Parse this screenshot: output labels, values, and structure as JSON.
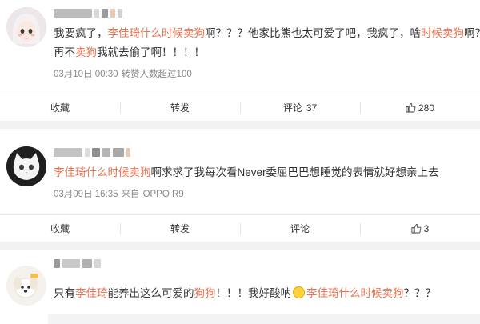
{
  "colors": {
    "highlight": "#eb7350",
    "meta": "#888888",
    "separator": "#f2f2f5"
  },
  "posts": [
    {
      "text_parts": [
        {
          "t": "我要疯了，",
          "hl": false
        },
        {
          "t": "李佳琦什么时候卖狗",
          "hl": true
        },
        {
          "t": "啊？？？他家比熊也太可爱了吧，我疯了，啥",
          "hl": false
        },
        {
          "t": "时候卖狗",
          "hl": true
        },
        {
          "t": "啊？",
          "hl": false
        }
      ],
      "text_parts_line2": [
        {
          "t": "再不",
          "hl": false
        },
        {
          "t": "卖狗",
          "hl": true
        },
        {
          "t": "我就去偷了啊！！！！",
          "hl": false
        }
      ],
      "date": "03月10日 00:30",
      "source": "转赞人数超过100",
      "actions": {
        "collect": "收藏",
        "forward": "转发",
        "comment": "评论",
        "comment_count": "37",
        "like_count": "280"
      },
      "avatar_icon": "girl-avatar-icon"
    },
    {
      "text_parts": [
        {
          "t": "李佳琦什么时候卖狗",
          "hl": true
        },
        {
          "t": "啊求求了我每次看Never委屈巴巴想睡觉的表情就好想亲上去",
          "hl": false
        }
      ],
      "date": "03月09日 16:35",
      "source_prefix": "来自",
      "source": "OPPO R9",
      "actions": {
        "collect": "收藏",
        "forward": "转发",
        "comment": "评论",
        "like_count": "3"
      },
      "avatar_icon": "white-cat-avatar-icon"
    },
    {
      "text_parts": [
        {
          "t": "只有",
          "hl": false
        },
        {
          "t": "李佳琦",
          "hl": true
        },
        {
          "t": "能养出这么可爱的",
          "hl": false
        },
        {
          "t": "狗狗",
          "hl": true
        },
        {
          "t": "！！！我好酸呐",
          "hl": false
        }
      ],
      "text_parts_tail": [
        {
          "t": "李佳琦什么时候卖狗",
          "hl": true
        },
        {
          "t": "？？？",
          "hl": false
        }
      ],
      "emoji_icon": "lemon-emoji-icon",
      "avatar_icon": "dog-avatar-icon"
    }
  ]
}
